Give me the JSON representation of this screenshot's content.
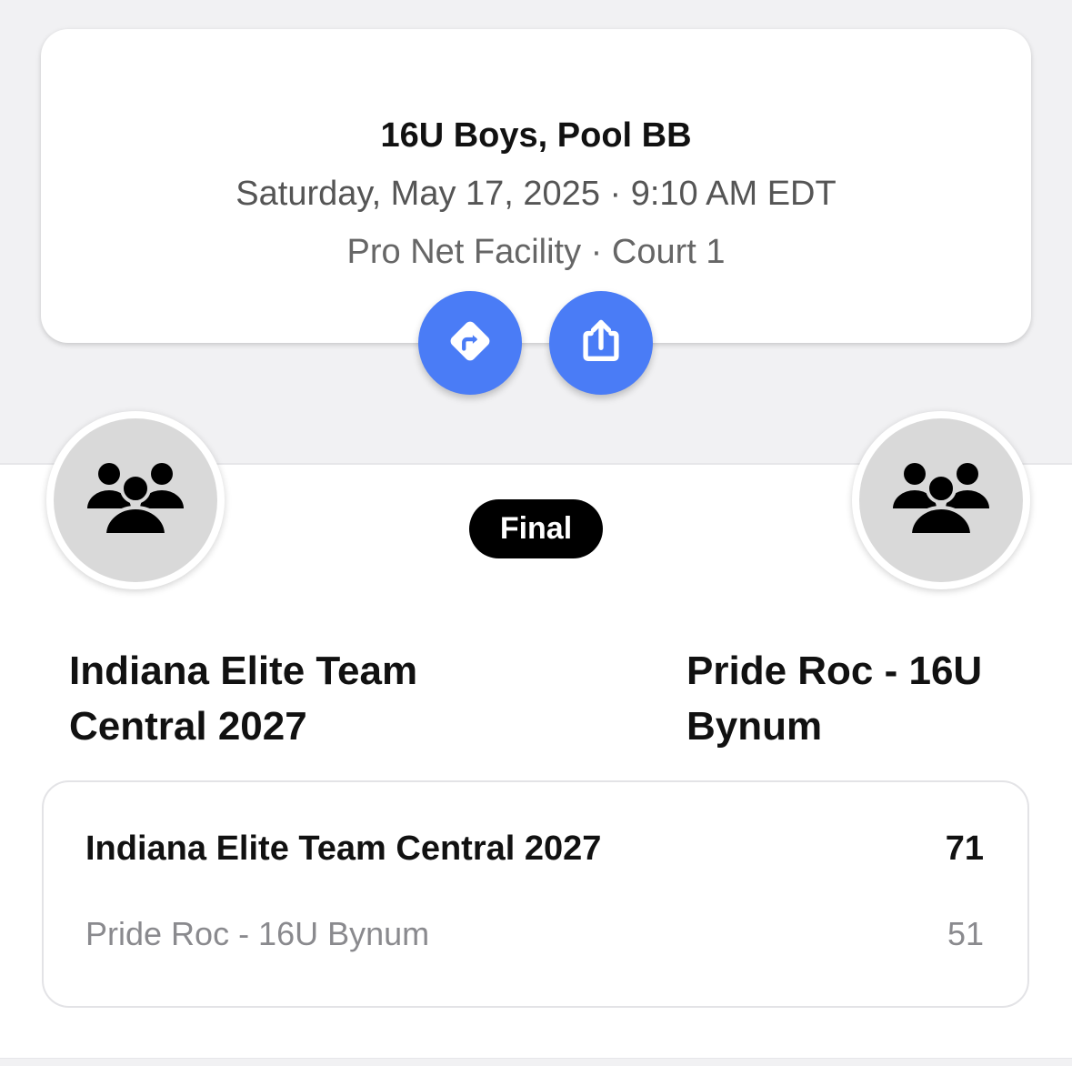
{
  "game": {
    "title": "16U Boys, Pool BB",
    "datetime": "Saturday, May 17, 2025 · 9:10 AM EDT",
    "location": "Pro Net Facility · Court 1",
    "status": "Final"
  },
  "actions": {
    "directions_icon": "directions-icon",
    "share_icon": "share-icon"
  },
  "teams": {
    "home": {
      "name": "Indiana Elite Team Central 2027",
      "avatar_icon": "team-group-icon"
    },
    "away": {
      "name": "Pride Roc - 16U Bynum",
      "avatar_icon": "team-group-icon"
    }
  },
  "scores": [
    {
      "team": "Indiana Elite Team Central 2027",
      "score": "71"
    },
    {
      "team": "Pride Roc - 16U Bynum",
      "score": "51"
    }
  ],
  "colors": {
    "accent": "#4a7cf6",
    "badge_bg": "#000000",
    "background": "#f1f1f3"
  }
}
